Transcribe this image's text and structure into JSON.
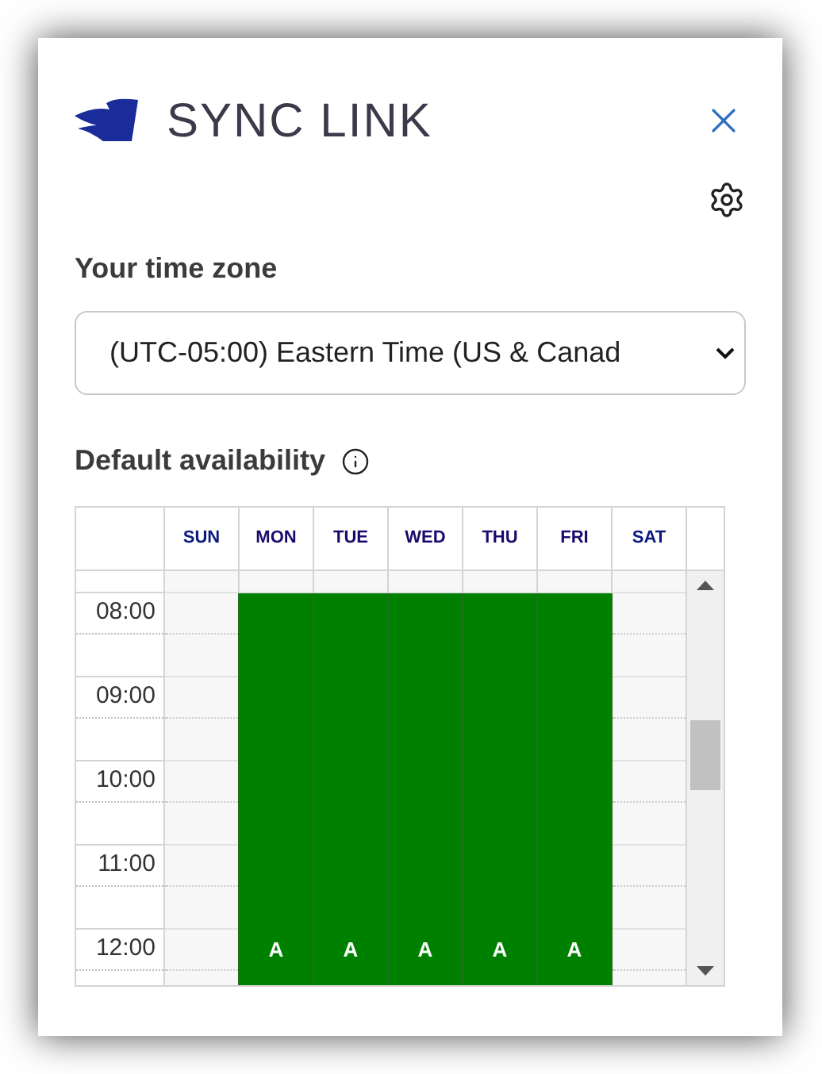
{
  "header": {
    "title": "SYNC LINK"
  },
  "timezone": {
    "label": "Your time zone",
    "value": "(UTC-05:00) Eastern Time (US & Canad"
  },
  "availability": {
    "label": "Default availability",
    "days": [
      {
        "label": "SUN",
        "available": false
      },
      {
        "label": "MON",
        "available": true,
        "marker": "A"
      },
      {
        "label": "TUE",
        "available": true,
        "marker": "A"
      },
      {
        "label": "WED",
        "available": true,
        "marker": "A"
      },
      {
        "label": "THU",
        "available": true,
        "marker": "A"
      },
      {
        "label": "FRI",
        "available": true,
        "marker": "A"
      },
      {
        "label": "SAT",
        "available": false
      }
    ],
    "hours": [
      "08:00",
      "09:00",
      "10:00",
      "11:00",
      "12:00"
    ]
  }
}
